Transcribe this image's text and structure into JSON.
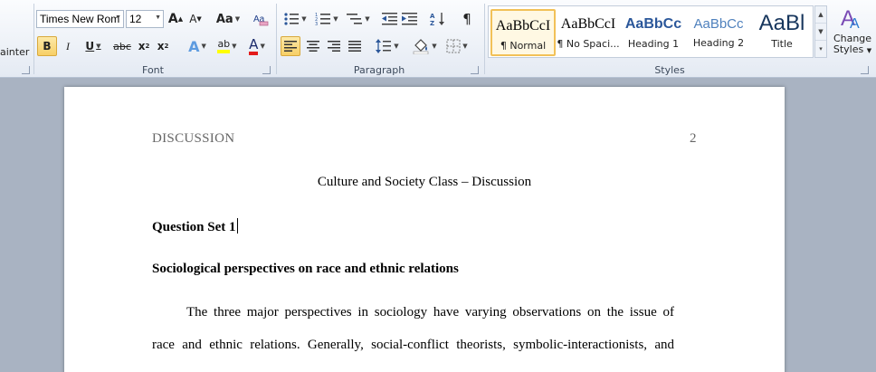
{
  "ribbon": {
    "clipboard": {
      "format_painter_label": "ainter"
    },
    "font": {
      "group_label": "Font",
      "font_name": "Times New Rom",
      "font_size": "12",
      "grow_label": "A",
      "shrink_label": "A",
      "case_label": "Aa",
      "bold_label": "B",
      "italic_label": "I",
      "underline_label": "U",
      "strike_label": "abc",
      "subscript_label": "x",
      "superscript_label": "x",
      "effects_label": "A",
      "highlight_label": "ab",
      "font_color_label": "A"
    },
    "paragraph": {
      "group_label": "Paragraph",
      "pilcrow": "¶"
    },
    "styles": {
      "group_label": "Styles",
      "items": [
        {
          "sample": "AaBbCcI",
          "name": "¶ Normal"
        },
        {
          "sample": "AaBbCcI",
          "name": "¶ No Spaci..."
        },
        {
          "sample": "AaBbCc",
          "name": "Heading 1"
        },
        {
          "sample": "AaBbCc",
          "name": "Heading 2"
        },
        {
          "sample": "AaBl",
          "name": "Title"
        }
      ],
      "change_styles_label_1": "Change",
      "change_styles_label_2": "Styles"
    },
    "colors": {
      "highlight": "#ffff00",
      "font_color": "#e31b1b",
      "heading_blue": "#2b579a"
    }
  },
  "document": {
    "header_left": "DISCUSSION",
    "header_right": "2",
    "title": "Culture and Society Class – Discussion",
    "question_heading": "Question Set 1",
    "subheading": "Sociological perspectives on race and ethnic relations",
    "paragraph_line_1": "The three major perspectives in sociology have varying observations on the issue of",
    "paragraph_line_2": "race and ethnic relations. Generally, social-conflict theorists, symbolic-interactionists, and"
  }
}
